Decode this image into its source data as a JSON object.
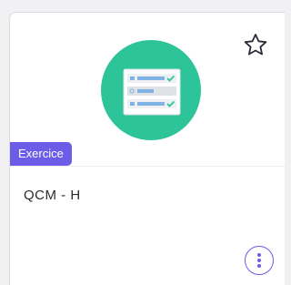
{
  "card": {
    "type_badge": "Exercice",
    "title": "QCM - H",
    "icons": {
      "favorite": "star-outline-icon",
      "menu": "more-vertical-icon",
      "illustration": "quiz-checklist-illustration"
    },
    "colors": {
      "accent": "#6c5ce7",
      "illustration_circle": "#2ec49a",
      "checkmark": "#2ec49a",
      "line_blue": "#7fb2e5"
    }
  }
}
